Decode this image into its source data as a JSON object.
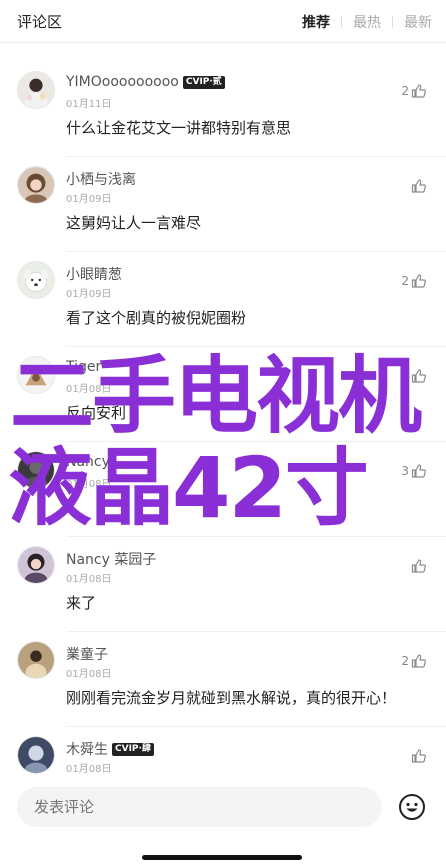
{
  "header": {
    "title": "评论区",
    "tabs": [
      {
        "label": "推荐",
        "active": true
      },
      {
        "label": "最热",
        "active": false
      },
      {
        "label": "最新",
        "active": false
      }
    ]
  },
  "comments": [
    {
      "user": "YIMOooooooooo",
      "vip": "CVIP·贰",
      "date": "01月11日",
      "text": "什么让金花艾文一讲都特别有意思",
      "likes": "2",
      "avatar": "girl-with-flowers-avatar"
    },
    {
      "user": "小栖与浅离",
      "vip": "",
      "date": "01月09日",
      "text": "这舅妈让人一言难尽",
      "likes": "",
      "avatar": "brown-hair-girl-avatar"
    },
    {
      "user": "小眼睛葱",
      "vip": "",
      "date": "01月09日",
      "text": "看了这个剧真的被倪妮圈粉",
      "likes": "2",
      "avatar": "white-dog-avatar"
    },
    {
      "user": "Tiger",
      "vip": "",
      "date": "01月08日",
      "text": "反向安利",
      "likes": "",
      "avatar": "cartoon-avatar"
    },
    {
      "user": "Nancy",
      "vip": "",
      "date": "01月08日",
      "text": "",
      "likes": "3",
      "avatar": "dark-avatar"
    },
    {
      "user": "Nancy 菜园子",
      "vip": "",
      "date": "01月08日",
      "text": "来了",
      "likes": "",
      "avatar": "woman-portrait-avatar"
    },
    {
      "user": "業童子",
      "vip": "",
      "date": "01月08日",
      "text": "刚刚看完流金岁月就碰到黑水解说，真的很开心！",
      "likes": "2",
      "avatar": "person-outdoor-avatar"
    },
    {
      "user": "木舜生",
      "vip": "CVIP·肆",
      "date": "01月08日",
      "text": "",
      "likes": "",
      "avatar": "blue-portrait-avatar"
    }
  ],
  "overlay": {
    "line1": "二手电视机",
    "line2": "液晶42寸"
  },
  "bottom": {
    "input_placeholder": "发表评论",
    "emoji_icon": "emoji-smile-icon"
  },
  "colors": {
    "overlay": "#8a2fd6",
    "text": "#222222",
    "muted": "#aaaaaa"
  }
}
